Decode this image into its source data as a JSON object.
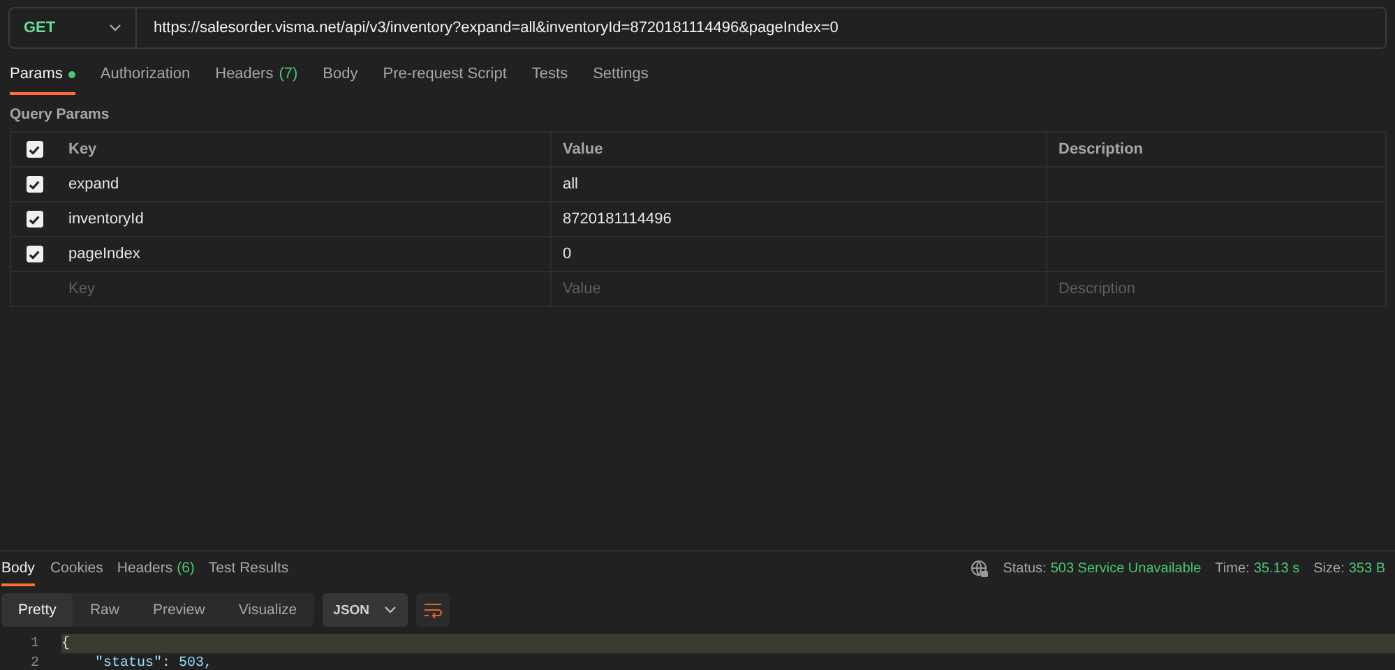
{
  "request": {
    "method": "GET",
    "url": "https://salesorder.visma.net/api/v3/inventory?expand=all&inventoryId=8720181114496&pageIndex=0"
  },
  "request_tabs": [
    {
      "label": "Params",
      "dot": true,
      "selected": true
    },
    {
      "label": "Authorization",
      "dot": false,
      "selected": false
    },
    {
      "label": "Headers",
      "count": "(7)",
      "dot": false,
      "selected": false
    },
    {
      "label": "Body",
      "dot": false,
      "selected": false
    },
    {
      "label": "Pre-request Script",
      "dot": false,
      "selected": false
    },
    {
      "label": "Tests",
      "dot": false,
      "selected": false
    },
    {
      "label": "Settings",
      "dot": false,
      "selected": false
    }
  ],
  "query_params": {
    "title": "Query Params",
    "header": {
      "checked": true,
      "key": "Key",
      "value": "Value",
      "description": "Description"
    },
    "rows": [
      {
        "checked": true,
        "key": "expand",
        "value": "all"
      },
      {
        "checked": true,
        "key": "inventoryId",
        "value": "8720181114496"
      },
      {
        "checked": true,
        "key": "pageIndex",
        "value": "0"
      }
    ],
    "new_row": {
      "key_placeholder": "Key",
      "value_placeholder": "Value",
      "description_placeholder": "Description"
    }
  },
  "response_tabs": [
    {
      "label": "Body",
      "selected": true
    },
    {
      "label": "Cookies",
      "selected": false
    },
    {
      "label": "Headers",
      "count": "(6)",
      "selected": false
    },
    {
      "label": "Test Results",
      "selected": false
    }
  ],
  "response_status": {
    "status_label": "Status:",
    "status": "503 Service Unavailable",
    "time_label": "Time:",
    "time": "35.13 s",
    "size_label": "Size:",
    "size": "353 B"
  },
  "view_modes": [
    {
      "label": "Pretty",
      "selected": true
    },
    {
      "label": "Raw",
      "selected": false
    },
    {
      "label": "Preview",
      "selected": false
    },
    {
      "label": "Visualize",
      "selected": false
    }
  ],
  "format": "JSON",
  "code_lines": [
    {
      "number": "1",
      "text": "{",
      "highlighted": true
    },
    {
      "number": "2",
      "text": "    \"status\": 503,",
      "highlighted": false
    }
  ]
}
